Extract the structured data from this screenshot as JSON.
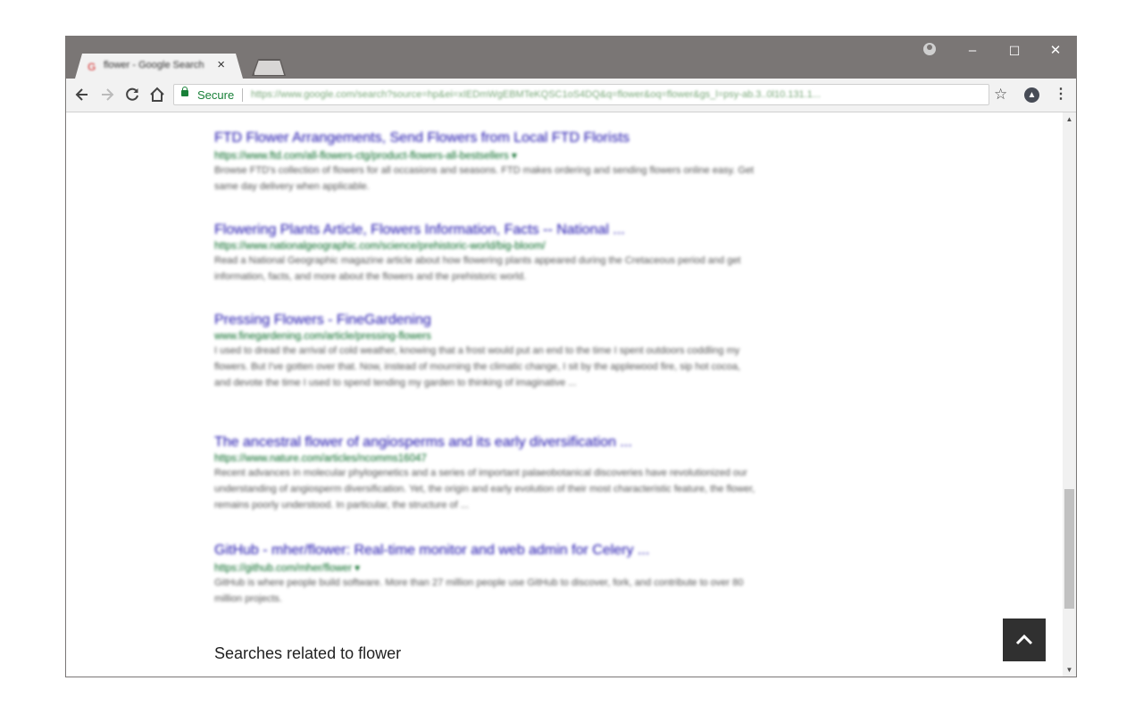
{
  "browser": {
    "tab": {
      "title": "flower - Google Search",
      "favicon": "google-icon"
    },
    "omnibox": {
      "secure_label": "Secure",
      "url": "https://www.google.com/search?source=hp&ei=xIEDmWgEBMTeKQSC1oS4DQ&q=flower&oq=flower&gs_l=psy-ab.3..0l10.131.1..."
    },
    "window_controls": {
      "minimize": "–",
      "maximize": "☐",
      "close": "✕"
    }
  },
  "results": [
    {
      "title": "FTD Flower Arrangements, Send Flowers from Local FTD Florists",
      "url": "https://www.ftd.com/all-flowers-ctg/product-flowers-all-bestsellers ▾",
      "snippet": "Browse FTD's collection of flowers for all occasions and seasons. FTD makes ordering and sending flowers online easy. Get same day delivery when applicable."
    },
    {
      "title": "Flowering Plants Article, Flowers Information, Facts -- National ...",
      "url": "https://www.nationalgeographic.com/science/prehistoric-world/big-bloom/",
      "snippet": "Read a National Geographic magazine article about how flowering plants appeared during the Cretaceous period and get information, facts, and more about the flowers and the prehistoric world."
    },
    {
      "title": "Pressing Flowers - FineGardening",
      "url": "www.finegardening.com/article/pressing-flowers",
      "snippet": "I used to dread the arrival of cold weather, knowing that a frost would put an end to the time I spent outdoors coddling my flowers. But I've gotten over that. Now, instead of mourning the climatic change, I sit by the applewood fire, sip hot cocoa, and devote the time I used to spend tending my garden to thinking of imaginative ..."
    },
    {
      "title": "The ancestral flower of angiosperms and its early diversification ...",
      "url": "https://www.nature.com/articles/ncomms16047",
      "snippet": "Recent advances in molecular phylogenetics and a series of important palaeobotanical discoveries have revolutionized our understanding of angiosperm diversification. Yet, the origin and early evolution of their most characteristic feature, the flower, remains poorly understood. In particular, the structure of ..."
    },
    {
      "title": "GitHub - mher/flower: Real-time monitor and web admin for Celery ...",
      "url": "https://github.com/mher/flower ▾",
      "snippet": "GitHub is where people build software. More than 27 million people use GitHub to discover, fork, and contribute to over 80 million projects."
    }
  ],
  "related_heading": "Searches related to flower"
}
